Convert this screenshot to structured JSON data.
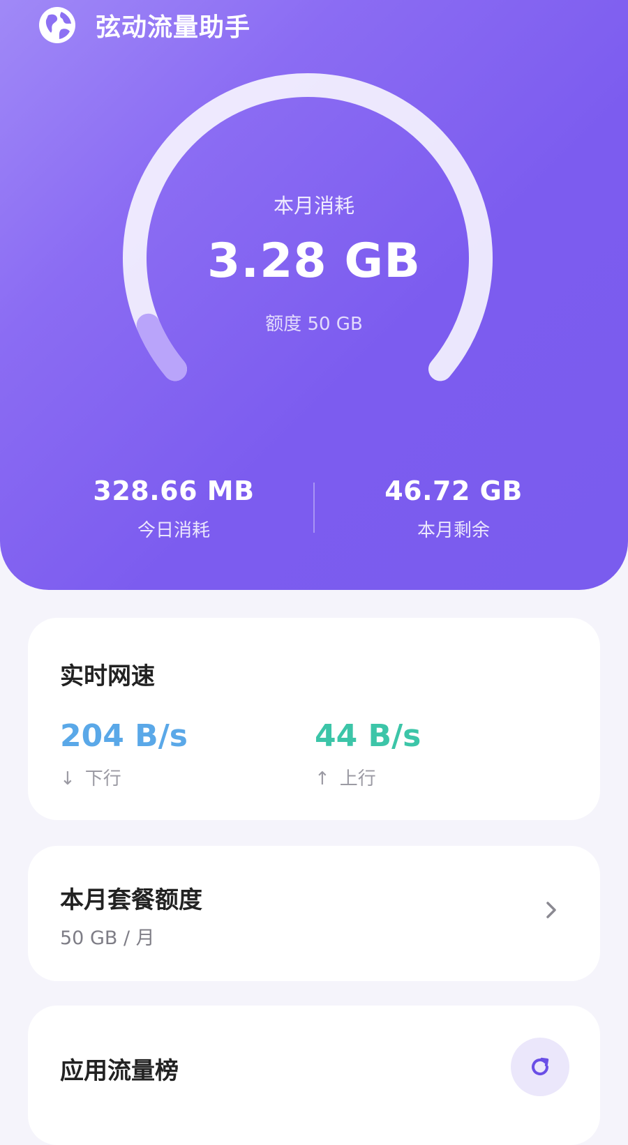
{
  "app": {
    "title": "弦动流量助手",
    "icon": "globe-icon"
  },
  "usage": {
    "label": "本月消耗",
    "value": "3.28 GB",
    "quota": "额度 50 GB",
    "used_fraction": 0.0656
  },
  "stats": {
    "today_value": "328.66 MB",
    "today_label": "今日消耗",
    "remaining_value": "46.72 GB",
    "remaining_label": "本月剩余"
  },
  "speed": {
    "title": "实时网速",
    "down_value": "204 B/s",
    "down_label": "下行",
    "down_icon": "arrow-down-icon",
    "up_value": "44 B/s",
    "up_label": "上行",
    "up_icon": "arrow-up-icon"
  },
  "plan": {
    "title": "本月套餐额度",
    "value": "50 GB / 月",
    "icon": "chevron-right-icon"
  },
  "ranking": {
    "title": "应用流量榜",
    "icon": "refresh-icon"
  },
  "colors": {
    "header_accent": "#7b5cef",
    "download": "#5aa8e8",
    "upload": "#3cc5a8",
    "background": "#f5f4fb"
  }
}
